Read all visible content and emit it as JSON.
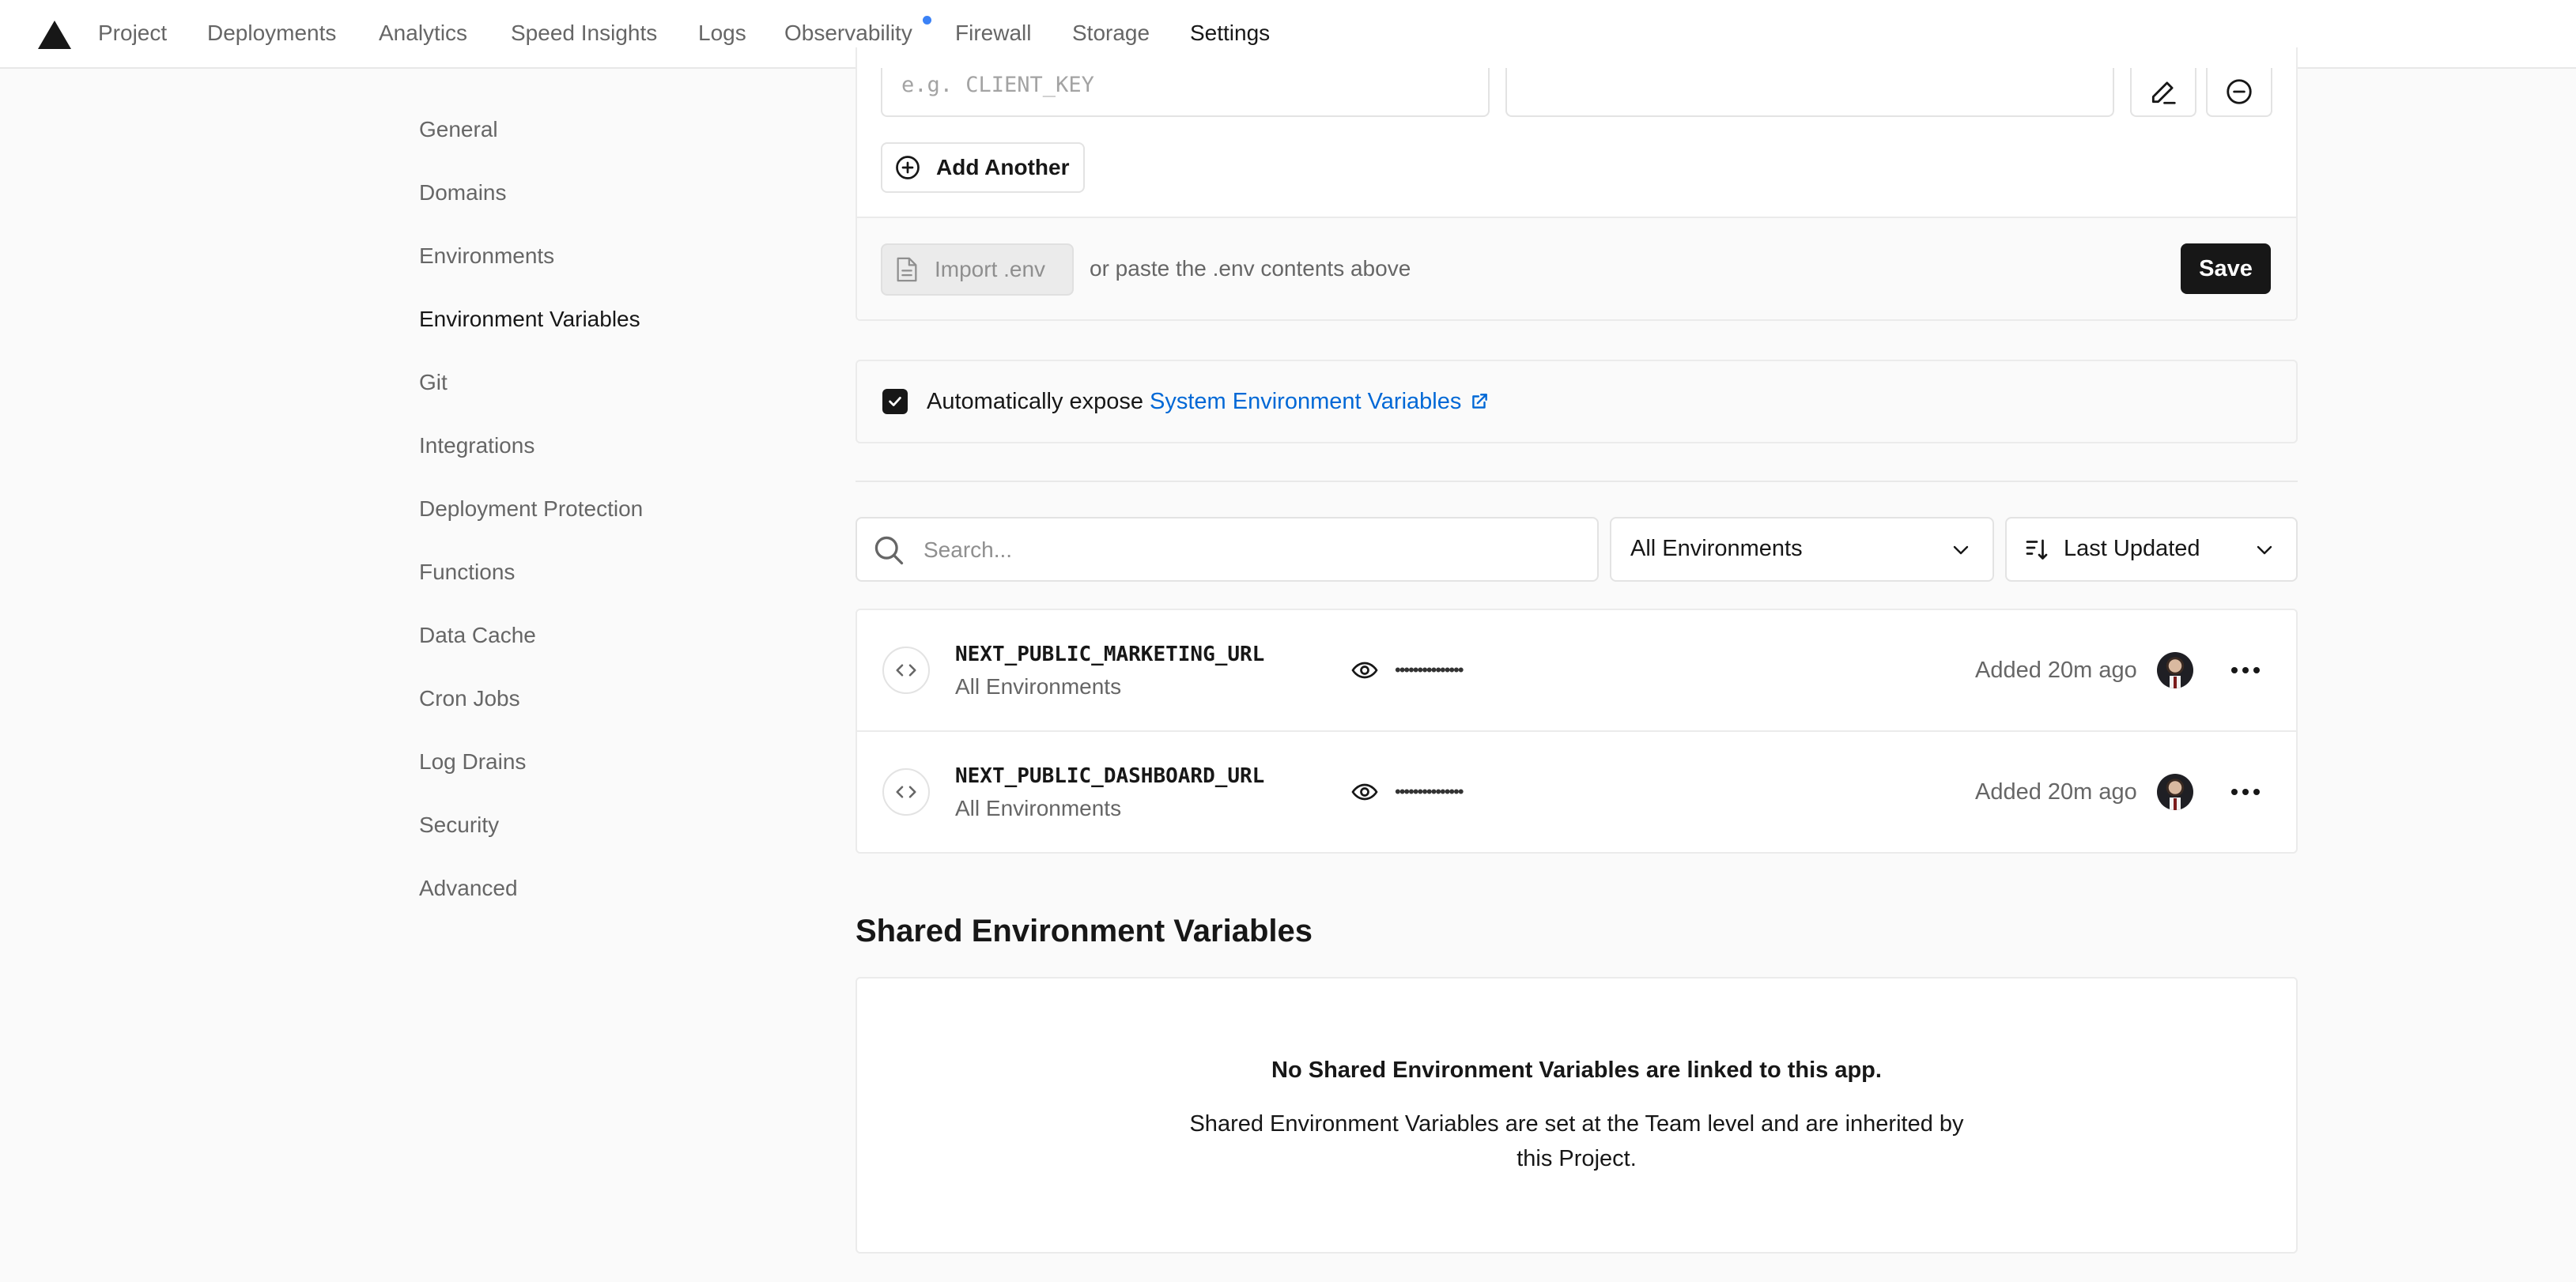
{
  "topnav": {
    "tabs": [
      {
        "label": "Project"
      },
      {
        "label": "Deployments"
      },
      {
        "label": "Analytics"
      },
      {
        "label": "Speed Insights"
      },
      {
        "label": "Logs"
      },
      {
        "label": "Observability"
      },
      {
        "label": "Firewall"
      },
      {
        "label": "Storage"
      },
      {
        "label": "Settings"
      }
    ],
    "active_tab": "Settings",
    "notification_dot_color": "#3b82f6"
  },
  "sidebar": {
    "items": [
      {
        "label": "General"
      },
      {
        "label": "Domains"
      },
      {
        "label": "Environments"
      },
      {
        "label": "Environment Variables"
      },
      {
        "label": "Git"
      },
      {
        "label": "Integrations"
      },
      {
        "label": "Deployment Protection"
      },
      {
        "label": "Functions"
      },
      {
        "label": "Data Cache"
      },
      {
        "label": "Cron Jobs"
      },
      {
        "label": "Log Drains"
      },
      {
        "label": "Security"
      },
      {
        "label": "Advanced"
      }
    ],
    "active_item": "Environment Variables"
  },
  "form": {
    "key_placeholder": "e.g. CLIENT_KEY",
    "value": "",
    "add_another_label": "Add Another",
    "import_label": "Import .env",
    "paste_hint": "or paste the .env contents above",
    "save_label": "Save"
  },
  "expose": {
    "checked": true,
    "text": "Automatically expose",
    "link_text": "System Environment Variables",
    "link_color": "#0068d6"
  },
  "filters": {
    "search_placeholder": "Search...",
    "environment_select": "All Environments",
    "sort_select": "Last Updated"
  },
  "variables": [
    {
      "name": "NEXT_PUBLIC_MARKETING_URL",
      "environment": "All Environments",
      "masked_value": "•••••••••••••••",
      "added": "Added 20m ago"
    },
    {
      "name": "NEXT_PUBLIC_DASHBOARD_URL",
      "environment": "All Environments",
      "masked_value": "•••••••••••••••",
      "added": "Added 20m ago"
    }
  ],
  "shared": {
    "title": "Shared Environment Variables",
    "empty_title": "No Shared Environment Variables are linked to this app.",
    "empty_description": "Shared Environment Variables are set at the Team level and are inherited by this Project."
  },
  "colors": {
    "primary_button": "#171717",
    "link": "#0068d6",
    "muted_text": "#666666",
    "border": "#ebebeb"
  }
}
